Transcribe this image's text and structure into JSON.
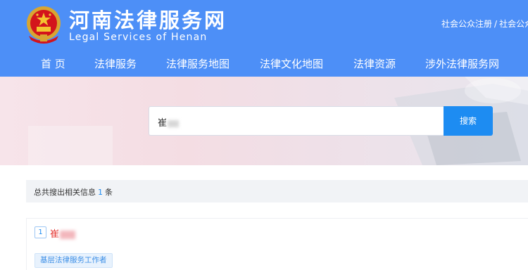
{
  "header": {
    "title": "河南法律服务网",
    "subtitle": "Legal Services of Henan",
    "top_links": [
      "社会公众注册",
      "社会公众"
    ],
    "top_link_separator": "/"
  },
  "nav": {
    "items": [
      {
        "label": "首 页"
      },
      {
        "label": "法律服务"
      },
      {
        "label": "法律服务地图"
      },
      {
        "label": "法律文化地图"
      },
      {
        "label": "法律资源"
      },
      {
        "label": "涉外法律服务网"
      }
    ]
  },
  "search": {
    "value": "崔",
    "button_label": "搜索"
  },
  "results": {
    "summary_prefix": "总共搜出相关信息",
    "count": "1",
    "summary_suffix": "条",
    "items": [
      {
        "index": "1",
        "name": "崔",
        "tag": "基层法律服务工作者"
      }
    ]
  },
  "colors": {
    "header_bg": "#4d8ff7",
    "accent": "#1d8cf2",
    "name_red": "#e53935"
  }
}
